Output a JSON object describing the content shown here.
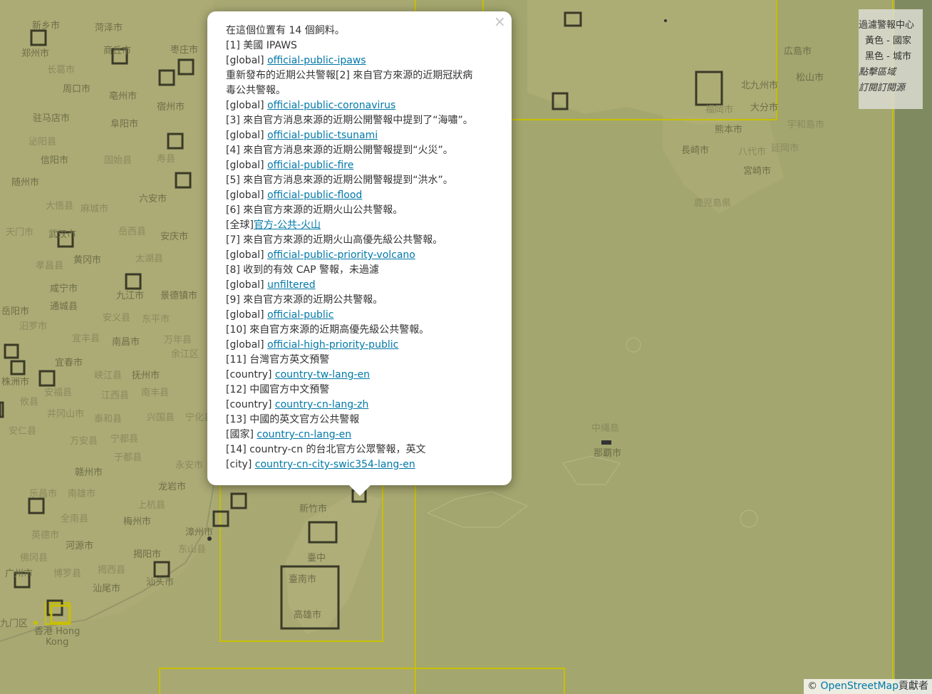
{
  "popup": {
    "close_label": "×",
    "header": "在這個位置有 14 個飼料。",
    "items": [
      {
        "title": "[1] 美國 IPAWS",
        "scope": "[global]",
        "link": "official-public-ipaws"
      },
      {
        "title": "重新發布的近期公共警報[2] 來自官方來源的近期冠狀病",
        "scope": "",
        "link": ""
      },
      {
        "title": "毒公共警報。",
        "scope": "[global]",
        "link": "official-public-coronavirus"
      },
      {
        "title": "[3] 來自官方消息來源的近期公開警報中提到了“海嘯”。",
        "scope": "[global]",
        "link": "official-public-tsunami"
      },
      {
        "title": "[4] 來自官方消息來源的近期公開警報提到“火災”。",
        "scope": "[global]",
        "link": "official-public-fire"
      },
      {
        "title": "[5] 來自官方消息來源的近期公開警報提到“洪水”。",
        "scope": "[global]",
        "link": "official-public-flood"
      },
      {
        "title": "[6] 來自官方來源的近期火山公共警報。",
        "scope": "[全球]",
        "link": "官方-公共-火山"
      },
      {
        "title": "[7] 來自官方來源的近期火山高優先級公共警報。",
        "scope": "[global]",
        "link": "official-public-priority-volcano"
      },
      {
        "title": "[8] 收到的有效 CAP 警報，未過濾",
        "scope": "[global]",
        "link": "unfiltered"
      },
      {
        "title": "[9] 來自官方來源的近期公共警報。",
        "scope": "[global]",
        "link": "official-public"
      },
      {
        "title": "[10] 來自官方來源的近期高優先級公共警報。",
        "scope": "[global]",
        "link": "official-high-priority-public"
      },
      {
        "title": "[11] 台灣官方英文預警",
        "scope": "[country]",
        "link": "country-tw-lang-en"
      },
      {
        "title": "[12] 中國官方中文預警",
        "scope": "[country]",
        "link": "country-cn-lang-zh"
      },
      {
        "title": "[13] 中國的英文官方公共警報",
        "scope": "[國家]",
        "link": "country-cn-lang-en"
      },
      {
        "title": "[14] country-cn 的台北官方公眾警報，英文",
        "scope": "[city]",
        "link": "country-cn-city-swic354-lang-en"
      }
    ]
  },
  "legend": {
    "title": "過濾警報中心",
    "yellow": "黃色 - 國家",
    "black": "黑色 - 城市",
    "click_region": "點擊區域",
    "subscribe": "訂閱訂閱源"
  },
  "attribution": {
    "prefix": "© ",
    "link": "OpenStreetMap",
    "suffix": "貢獻者"
  },
  "map_labels": [
    "新乡市",
    "菏泽市",
    "郑州市",
    "商丘市",
    "枣庄市",
    "长葛市",
    "周口市",
    "亳州市",
    "宿州市",
    "驻马店市",
    "阜阳市",
    "泌阳县",
    "信阳市",
    "固始县",
    "寿县",
    "六安市",
    "随州市",
    "大悟县",
    "麻城市",
    "天门市",
    "武汉市",
    "岳西县",
    "安庆市",
    "黄冈市",
    "太湖县",
    "孝昌县",
    "咸宁市",
    "九江市",
    "景德镇市",
    "岳阳市",
    "通城县",
    "安义县",
    "东平市",
    "汨罗市",
    "宜丰县",
    "南昌市",
    "万年县",
    "余江区",
    "宜春市",
    "峡江县",
    "抚州市",
    "南丰县",
    "株洲市",
    "安福县",
    "江西县",
    "攸县",
    "井冈山市",
    "泰和县",
    "兴国县",
    "宁化县",
    "安仁县",
    "万安县",
    "宁都县",
    "于都县",
    "赣州市",
    "永安市",
    "龙岩市",
    "上杭县",
    "漳州市",
    "东山县",
    "梅州市",
    "全南县",
    "乐昌市",
    "南雄市",
    "英德市",
    "河源市",
    "揭阳市",
    "汕头市",
    "广州市",
    "博罗县",
    "揭西县",
    "汕尾市",
    "佛冈县",
    "香港 Hong",
    "Kong",
    "九门区",
    "新竹市",
    "臺中",
    "臺南市",
    "高雄市",
    "広島市",
    "松山市",
    "北九州市",
    "大分市",
    "熊本市",
    "長崎市",
    "八代市",
    "延岡市",
    "宮崎市",
    "宇和島市",
    "鹿児島県",
    "中縄島",
    "那覇市",
    "福岡市"
  ],
  "colors": {
    "map_bg": "#a8a873",
    "country_border": "#c8c000",
    "city_border": "#3a3a28",
    "link": "#0078a8"
  }
}
